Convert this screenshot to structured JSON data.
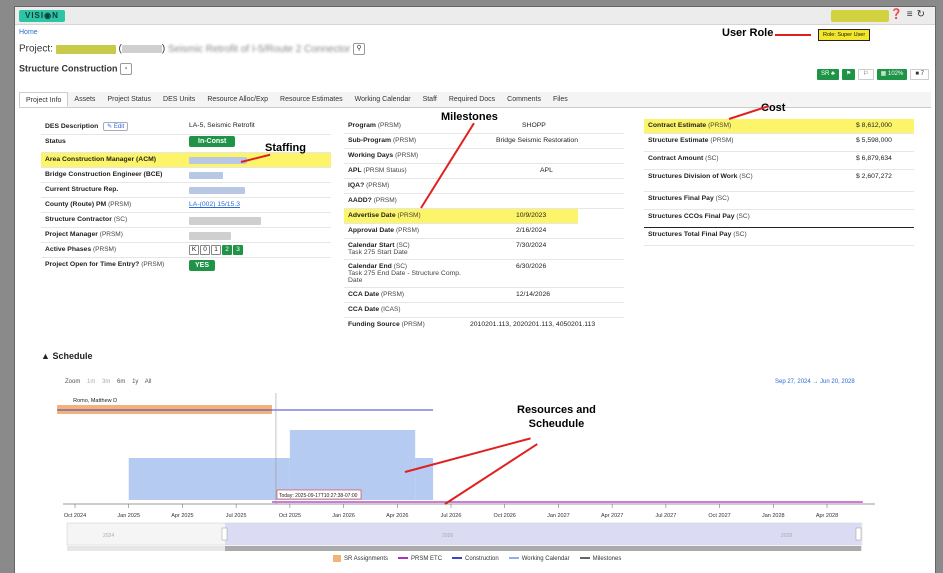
{
  "app": {
    "logo": "VISI◉N",
    "home": "Home",
    "user_role": "Role: Super User"
  },
  "project": {
    "label": "Project:",
    "name": "Seismic Retrofit of I-5/Route 2 Connector",
    "paren_open": "(",
    "paren_close": ")"
  },
  "structure": {
    "label": "Structure Construction"
  },
  "toolbar": {
    "sr": "SR ♣",
    "flag": "⚑",
    "flag2": "⚐",
    "percent": "▦ 102%",
    "doc": "■ 7"
  },
  "tabs": [
    "Project Info",
    "Assets",
    "Project Status",
    "DES Units",
    "Resource Alloc/Exp",
    "Resource Estimates",
    "Working Calendar",
    "Staff",
    "Required Docs",
    "Comments",
    "Files"
  ],
  "col1": {
    "des_description": {
      "label": "DES Description",
      "edit": "✎ Edit",
      "value": "LA-5, Seismic Retrofit"
    },
    "status": {
      "label": "Status",
      "value": "In-Const"
    },
    "acm": {
      "label": "Area Construction Manager (ACM)"
    },
    "bce": {
      "label": "Bridge Construction Engineer (BCE)"
    },
    "csr": {
      "label": "Current Structure Rep."
    },
    "county": {
      "label": "County (Route) PM",
      "suffix": "(PRSM)",
      "value": "LA-(002) 15/15.3"
    },
    "contractor": {
      "label": "Structure Contractor",
      "suffix": "(SC)"
    },
    "pm": {
      "label": "Project Manager",
      "suffix": "(PRSM)"
    },
    "phases": {
      "label": "Active Phases",
      "suffix": "(PRSM)",
      "items": [
        "K",
        "0",
        "1",
        "2",
        "3"
      ]
    },
    "open_time": {
      "label": "Project Open for Time Entry?",
      "suffix": "(PRSM)",
      "value": "YES"
    }
  },
  "col2": {
    "program": {
      "label": "Program",
      "suffix": "(PRSM)",
      "value": "SHOPP"
    },
    "sub_program": {
      "label": "Sub-Program",
      "suffix": "(PRSM)",
      "value": "Bridge Seismic Restoration"
    },
    "working_days": {
      "label": "Working Days",
      "suffix": "(PRSM)"
    },
    "apl": {
      "label": "APL",
      "suffix": "(PRSM Status)",
      "value": "APL"
    },
    "iqa": {
      "label": "IQA?",
      "suffix": "(PRSM)"
    },
    "aadd": {
      "label": "AADD?",
      "suffix": "(PRSM)"
    },
    "advertise": {
      "label": "Advertise Date",
      "suffix": "(PRSM)",
      "value": "10/9/2023"
    },
    "approval": {
      "label": "Approval Date",
      "suffix": "(PRSM)",
      "value": "2/16/2024"
    },
    "cal_start": {
      "label": "Calendar Start",
      "suffix": "(SC)",
      "sub": "Task 275 Start Date",
      "value": "7/30/2024"
    },
    "cal_end": {
      "label": "Calendar End",
      "suffix": "(SC)",
      "sub": "Task 275 End Date - Structure Comp. Date",
      "value": "6/30/2026"
    },
    "cca_prsm": {
      "label": "CCA Date",
      "suffix": "(PRSM)",
      "value": "12/14/2026"
    },
    "cca_icas": {
      "label": "CCA Date",
      "suffix": "(ICAS)"
    },
    "funding": {
      "label": "Funding Source",
      "suffix": "(PRSM)",
      "value": "2010201.113, 2020201.113, 4050201.113"
    }
  },
  "col3": {
    "contract_estimate": {
      "label": "Contract Estimate",
      "suffix": "(PRSM)",
      "value": "$ 8,612,000"
    },
    "structure_estimate": {
      "label": "Structure Estimate",
      "suffix": "(PRSM)",
      "value": "$ 5,598,000"
    },
    "contract_amount": {
      "label": "Contract Amount",
      "suffix": "(SC)",
      "value": "$ 6,879,634"
    },
    "sdw": {
      "label": "Structures Division of Work",
      "suffix": "(SC)",
      "value": "$ 2,607,272"
    },
    "final_pay": {
      "label": "Structures Final Pay",
      "suffix": "(SC)"
    },
    "cco_final": {
      "label": "Structures CCOs Final Pay",
      "suffix": "(SC)"
    },
    "total_final": {
      "label": "Structures Total Final Pay",
      "suffix": "(SC)"
    }
  },
  "annotations": {
    "user_role": "User Role",
    "cost": "Cost",
    "milestones": "Milestones",
    "staffing": "Staffing",
    "resources_1": "Resources and",
    "resources_2": "Scheudule"
  },
  "schedule": {
    "title": "Schedule",
    "zoom_label": "Zoom",
    "zoom_options": [
      "1m",
      "3m",
      "6m",
      "1y",
      "All"
    ],
    "date_range": "Sep 27, 2024 → Jun 20, 2028",
    "person_label": "Romo, Matthew D",
    "today_label": "Today: 2025-09-17T10:27:38-07:00",
    "x_axis": [
      "Oct 2024",
      "Jan 2025",
      "Apr 2025",
      "Jul 2025",
      "Oct 2025",
      "Jan 2026",
      "Apr 2026",
      "Jul 2026",
      "Oct 2026",
      "Jan 2027",
      "Apr 2027",
      "Jul 2027",
      "Oct 2027",
      "Jan 2028",
      "Apr 2028"
    ],
    "nav_years": [
      "2024",
      "2026",
      "2028"
    ],
    "legend": [
      "SR Assignments",
      "PRSM ETC",
      "Construction",
      "Working Calendar",
      "Milestones"
    ]
  },
  "colors": {
    "accent_green": "#1f9447",
    "highlight": "#fdf569",
    "sr": "#f2b27a",
    "prsm": "#b02ec0",
    "construction": "#4040c8",
    "working": "#8fb0ea"
  },
  "chart_data": {
    "type": "area",
    "x": [
      "Oct 2024",
      "Jan 2025",
      "Apr 2025",
      "Jul 2025",
      "Oct 2025",
      "Jan 2026",
      "Apr 2026",
      "Jul 2026",
      "Oct 2026",
      "Jan 2027",
      "Apr 2027",
      "Jul 2027",
      "Oct 2027",
      "Jan 2028",
      "Apr 2028"
    ],
    "series": [
      {
        "name": "Working Calendar",
        "segments": [
          {
            "start": "2025-01",
            "end": "2025-10",
            "level": 0.6
          },
          {
            "start": "2025-10",
            "end": "2026-05",
            "level": 1.0
          },
          {
            "start": "2026-05",
            "end": "2026-06",
            "level": 0.6
          }
        ]
      },
      {
        "name": "SR Assignments",
        "bar": {
          "start": "2024-09",
          "end": "2025-09"
        }
      },
      {
        "name": "Construction",
        "line": {
          "start": "2024-09",
          "end": "2026-06"
        }
      },
      {
        "name": "PRSM ETC",
        "line": {
          "start": "2025-09",
          "end": "2028-06"
        }
      }
    ],
    "grid": false,
    "legend": "bottom"
  }
}
